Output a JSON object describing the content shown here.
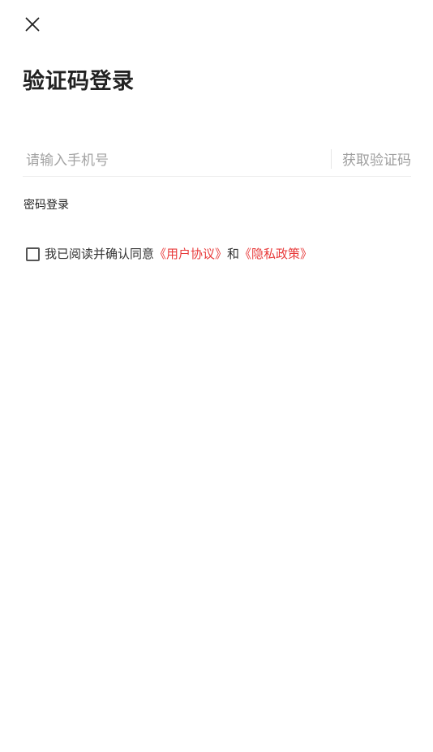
{
  "header": {
    "close_icon": "close-icon"
  },
  "page": {
    "title": "验证码登录"
  },
  "phone": {
    "placeholder": "请输入手机号",
    "value": "",
    "get_code_label": "获取验证码"
  },
  "password_login_label": "密码登录",
  "agreement": {
    "checked": false,
    "prefix": "我已阅读并确认同意",
    "user_agreement": "《用户协议》",
    "and": "和",
    "privacy_policy": "《隐私政策》"
  },
  "colors": {
    "link": "#e83a3a",
    "placeholder": "#a3a3a3",
    "get_code": "#9e9e9e",
    "text": "#222222"
  }
}
